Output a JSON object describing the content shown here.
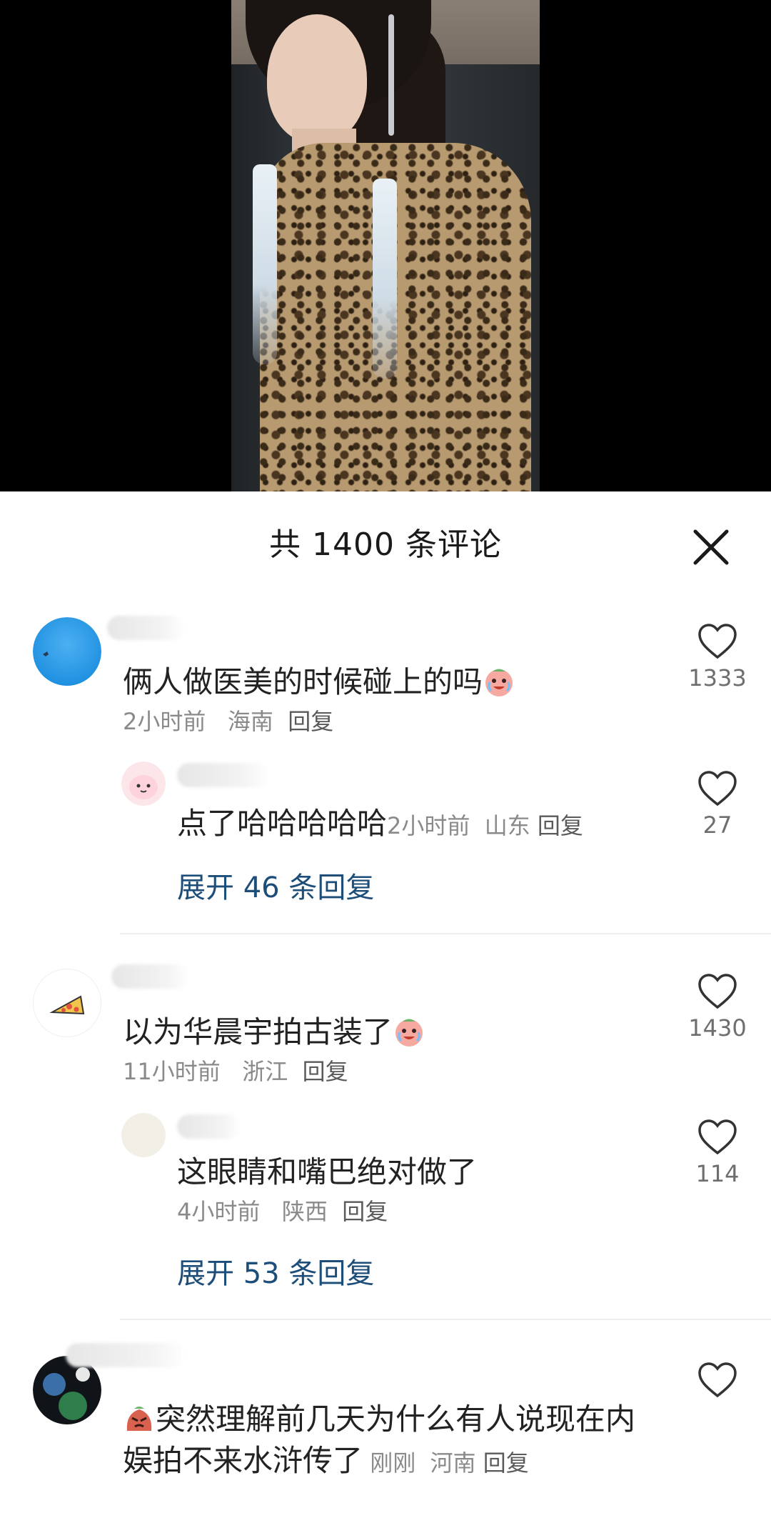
{
  "header": {
    "title": "共 1400 条评论",
    "close_icon": "close-icon"
  },
  "comments": [
    {
      "text": "俩人做医美的时候碰上的吗",
      "emoji": "crying-laughing-emoji",
      "time": "2小时前",
      "location": "海南",
      "reply_label": "回复",
      "likes": "1333",
      "replies": [
        {
          "text": "点了哈哈哈哈哈",
          "time": "2小时前",
          "location": "山东",
          "reply_label": "回复",
          "likes": "27"
        }
      ],
      "expand_label": "展开 46 条回复"
    },
    {
      "text": "以为华晨宇拍古装了",
      "emoji": "crying-laughing-emoji",
      "time": "11小时前",
      "location": "浙江",
      "reply_label": "回复",
      "likes": "1430",
      "replies": [
        {
          "text": "这眼睛和嘴巴绝对做了",
          "time": "4小时前",
          "location": "陕西",
          "reply_label": "回复",
          "likes": "114"
        }
      ],
      "expand_label": "展开 53 条回复"
    },
    {
      "text_line1": "突然理解前几天为什么有人说现在内",
      "text_line2": "娱拍不来水浒传了",
      "emoji": "angry-face-emoji",
      "time": "刚刚",
      "location": "河南",
      "reply_label": "回复",
      "likes": ""
    }
  ],
  "colors": {
    "expand_link": "#1d4e79",
    "meta_gray": "#8a8a8a",
    "text": "#222222"
  }
}
